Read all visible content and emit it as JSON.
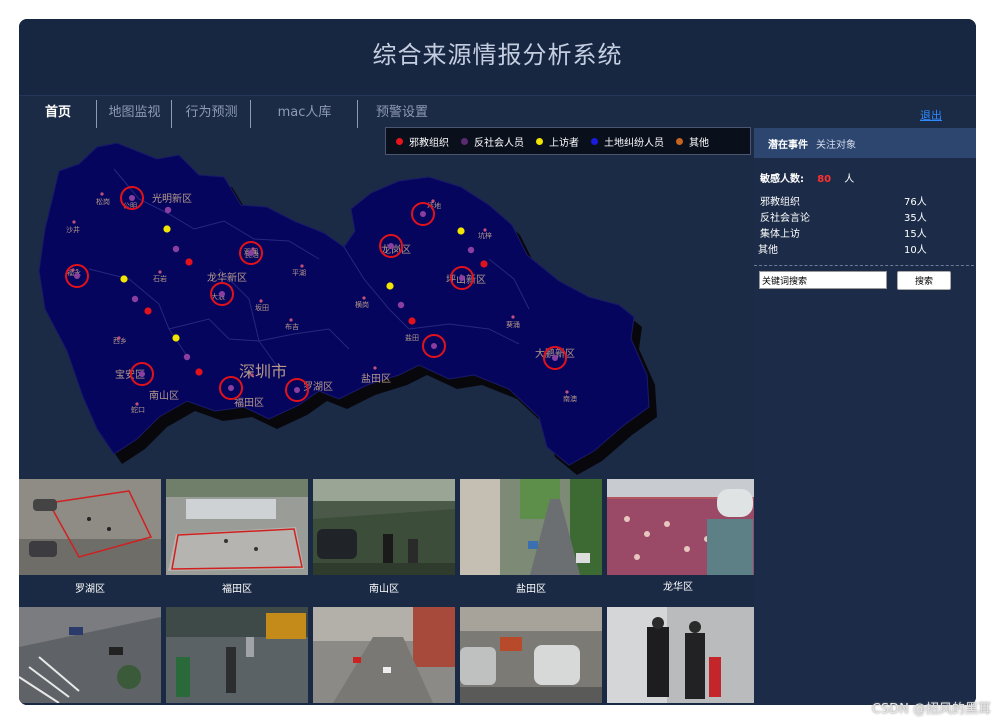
{
  "header": {
    "title": "综合来源情报分析系统"
  },
  "nav": {
    "tabs": [
      {
        "label": "首页",
        "active": true
      },
      {
        "label": "地图监视"
      },
      {
        "label": "行为预测"
      },
      {
        "label": "mac人库"
      },
      {
        "label": "预警设置"
      }
    ],
    "logout": "退出"
  },
  "legend": [
    {
      "label": "邪教组织",
      "color": "#e8141c"
    },
    {
      "label": "反社会人员",
      "color": "#5b2a73"
    },
    {
      "label": "上访者",
      "color": "#f2e500"
    },
    {
      "label": "土地纠纷人员",
      "color": "#1b1bdc"
    },
    {
      "label": "其他",
      "color": "#c8641e"
    }
  ],
  "map": {
    "city": "深圳市",
    "districts": [
      "光明新区",
      "龙华新区",
      "龙岗区",
      "坪山新区",
      "大鹏新区",
      "宝安区",
      "南山区",
      "福田区",
      "罗湖区",
      "盐田区"
    ],
    "places": [
      "松岗",
      "公明",
      "沙井",
      "福永",
      "石岩",
      "观澜",
      "平湖",
      "坂田",
      "布吉",
      "大浪",
      "西乡",
      "横岗",
      "坑梓",
      "坪地",
      "葵涌",
      "南澳",
      "蛇口",
      "盐田",
      "民治"
    ]
  },
  "panel": {
    "tabs": [
      "潜在事件",
      "关注对象"
    ],
    "sensitive": {
      "label": "敏感人数:",
      "count": "80",
      "unit": "人"
    },
    "stats": [
      {
        "name": "邪教组织",
        "value": "76人"
      },
      {
        "name": "反社会言论",
        "value": "35人"
      },
      {
        "name": "集体上访",
        "value": "15人"
      },
      {
        "name": "其他",
        "value": "10人"
      }
    ],
    "search": {
      "value": "关键词搜索",
      "button": "搜索"
    }
  },
  "cameras": [
    {
      "label": "罗湖区"
    },
    {
      "label": "福田区"
    },
    {
      "label": "南山区"
    },
    {
      "label": "盐田区"
    },
    {
      "label": "龙华区"
    }
  ],
  "watermark": "CSDN @招风的黑耳"
}
